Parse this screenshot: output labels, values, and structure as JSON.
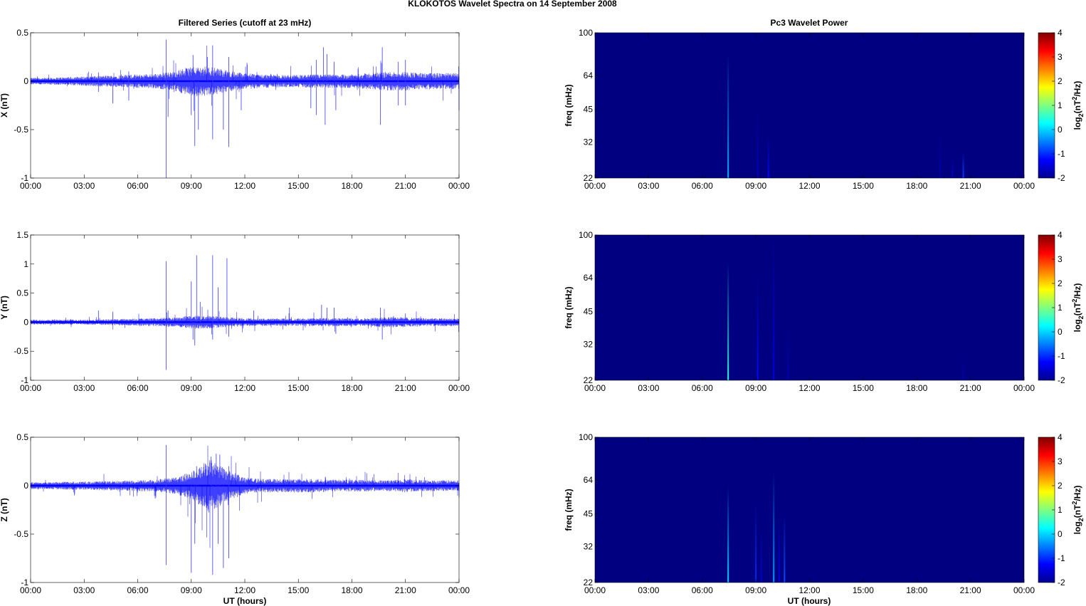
{
  "chart_data": {
    "title": "KLOKOTOS Wavelet Spectra on 14 September 2008",
    "left_title": "Filtered Series (cutoff at 23 mHz)",
    "right_title": "Pc3 Wavelet Power",
    "xlabel": "UT (hours)",
    "xticks": [
      "00:00",
      "03:00",
      "06:00",
      "09:00",
      "12:00",
      "15:00",
      "18:00",
      "21:00",
      "00:00"
    ],
    "xlim_hours": [
      0,
      24
    ],
    "series": [
      {
        "type": "line",
        "name": "X",
        "ylabel": "X (nT)",
        "ylim": [
          -1,
          0.5
        ],
        "yticks": [
          0.5,
          0,
          -0.5,
          -1
        ],
        "ytick_labels": [
          "0.5",
          "0",
          "-0.5",
          "-1"
        ],
        "noise_amp_hourly": [
          0.025,
          0.025,
          0.03,
          0.035,
          0.04,
          0.045,
          0.05,
          0.055,
          0.07,
          0.11,
          0.11,
          0.08,
          0.06,
          0.05,
          0.045,
          0.045,
          0.05,
          0.05,
          0.05,
          0.06,
          0.07,
          0.07,
          0.06,
          0.06,
          0.06
        ],
        "spikes": [
          [
            3.8,
            0.09
          ],
          [
            3.8,
            -0.11
          ],
          [
            4.6,
            -0.23
          ],
          [
            5.5,
            -0.2
          ],
          [
            5.5,
            0.1
          ],
          [
            7.6,
            0.43
          ],
          [
            7.6,
            -1.0
          ],
          [
            7.7,
            -0.37
          ],
          [
            9.0,
            -0.35
          ],
          [
            9.1,
            0.27
          ],
          [
            9.2,
            -0.67
          ],
          [
            9.4,
            -0.5
          ],
          [
            9.9,
            0.25
          ],
          [
            10.2,
            0.37
          ],
          [
            10.2,
            -0.6
          ],
          [
            10.8,
            -0.5
          ],
          [
            11.1,
            0.25
          ],
          [
            11.1,
            -0.68
          ],
          [
            11.8,
            -0.3
          ],
          [
            15.7,
            -0.28
          ],
          [
            16.0,
            0.22
          ],
          [
            16.0,
            -0.35
          ],
          [
            16.4,
            0.35
          ],
          [
            16.5,
            -0.45
          ],
          [
            16.6,
            0.28
          ],
          [
            17.0,
            0.2
          ],
          [
            17.1,
            -0.3
          ],
          [
            19.6,
            -0.45
          ],
          [
            19.7,
            0.35
          ],
          [
            20.6,
            0.2
          ],
          [
            20.6,
            -0.25
          ],
          [
            21.0,
            0.22
          ],
          [
            21.0,
            -0.25
          ],
          [
            24.0,
            -0.3
          ]
        ]
      },
      {
        "type": "line",
        "name": "Y",
        "ylabel": "Y (nT)",
        "ylim": [
          -1,
          1.5
        ],
        "yticks": [
          1.5,
          1,
          0.5,
          0,
          -0.5,
          -1
        ],
        "ytick_labels": [
          "1.5",
          "1",
          "0.5",
          "0",
          "-0.5",
          "-1"
        ],
        "noise_amp_hourly": [
          0.03,
          0.03,
          0.03,
          0.03,
          0.035,
          0.04,
          0.045,
          0.05,
          0.06,
          0.08,
          0.08,
          0.06,
          0.05,
          0.045,
          0.045,
          0.045,
          0.05,
          0.05,
          0.05,
          0.05,
          0.07,
          0.06,
          0.05,
          0.05,
          0.05
        ],
        "spikes": [
          [
            3.8,
            0.2
          ],
          [
            4.6,
            0.18
          ],
          [
            7.6,
            1.05
          ],
          [
            7.6,
            -0.82
          ],
          [
            7.7,
            0.2
          ],
          [
            9.0,
            0.7
          ],
          [
            9.1,
            -0.3
          ],
          [
            9.3,
            1.15
          ],
          [
            9.2,
            -0.4
          ],
          [
            9.5,
            0.35
          ],
          [
            10.2,
            1.15
          ],
          [
            10.2,
            -0.3
          ],
          [
            10.5,
            0.6
          ],
          [
            11.0,
            1.1
          ],
          [
            11.1,
            -0.25
          ],
          [
            12.5,
            0.2
          ],
          [
            14.5,
            0.25
          ],
          [
            16.3,
            0.3
          ],
          [
            16.6,
            0.25
          ],
          [
            17.0,
            0.25
          ],
          [
            17.1,
            -0.2
          ],
          [
            19.6,
            0.25
          ],
          [
            19.7,
            -0.3
          ],
          [
            21.0,
            0.15
          ]
        ]
      },
      {
        "type": "line",
        "name": "Z",
        "ylabel": "Z (nT)",
        "ylim": [
          -1,
          0.5
        ],
        "yticks": [
          0.5,
          0,
          -0.5,
          -1
        ],
        "ytick_labels": [
          "0.5",
          "0",
          "-0.5",
          "-1"
        ],
        "noise_amp_hourly": [
          0.025,
          0.025,
          0.03,
          0.03,
          0.035,
          0.035,
          0.04,
          0.045,
          0.06,
          0.1,
          0.2,
          0.12,
          0.06,
          0.05,
          0.05,
          0.05,
          0.05,
          0.045,
          0.045,
          0.04,
          0.04,
          0.05,
          0.04,
          0.04,
          0.04
        ],
        "spikes": [
          [
            7.6,
            0.42
          ],
          [
            7.6,
            -0.82
          ],
          [
            9.0,
            -0.9
          ],
          [
            9.2,
            -0.6
          ],
          [
            9.3,
            0.2
          ],
          [
            10.1,
            0.3
          ],
          [
            10.2,
            -0.92
          ],
          [
            10.4,
            0.33
          ],
          [
            10.5,
            -0.6
          ],
          [
            10.6,
            0.32
          ],
          [
            10.8,
            -0.85
          ],
          [
            11.1,
            -0.75
          ],
          [
            11.1,
            0.2
          ],
          [
            24.0,
            -0.12
          ]
        ]
      }
    ],
    "wavelets": [
      {
        "type": "heatmap",
        "name": "X",
        "ylabel": "freq (mHz)",
        "ylim_mhz": [
          22,
          100
        ],
        "yscale": "log",
        "yticks": [
          100,
          64,
          45,
          32,
          22
        ],
        "background_log2": -2,
        "streaks": [
          [
            7.45,
            -0.2,
            80
          ],
          [
            9.1,
            -1.6,
            45
          ],
          [
            9.7,
            -1.2,
            34
          ],
          [
            19.3,
            -1.7,
            35
          ],
          [
            20.0,
            -1.6,
            28
          ],
          [
            20.6,
            -0.9,
            29
          ]
        ]
      },
      {
        "type": "heatmap",
        "name": "Y",
        "ylabel": "freq (mHz)",
        "ylim_mhz": [
          22,
          100
        ],
        "yscale": "log",
        "yticks": [
          100,
          64,
          45,
          32,
          22
        ],
        "background_log2": -2,
        "streaks": [
          [
            7.45,
            0.5,
            75
          ],
          [
            9.1,
            -1.2,
            65
          ],
          [
            10.0,
            -1.4,
            100
          ],
          [
            10.8,
            -1.7,
            40
          ],
          [
            20.6,
            -1.7,
            28
          ]
        ]
      },
      {
        "type": "heatmap",
        "name": "Z",
        "ylabel": "freq (mHz)",
        "ylim_mhz": [
          22,
          100
        ],
        "yscale": "log",
        "yticks": [
          100,
          64,
          45,
          32,
          22
        ],
        "background_log2": -2,
        "streaks": [
          [
            7.45,
            0.0,
            60
          ],
          [
            9.0,
            -1.0,
            50
          ],
          [
            9.3,
            -1.5,
            40
          ],
          [
            10.0,
            -0.3,
            70
          ],
          [
            10.3,
            -1.4,
            45
          ],
          [
            10.6,
            -0.8,
            45
          ]
        ]
      }
    ],
    "colorbar": {
      "label": "log2(nT2/Hz)",
      "label_main": "log",
      "label_sub": "2",
      "label_rest": "(nT",
      "label_sup": "2",
      "label_end": "/Hz)",
      "range": [
        -2,
        4
      ],
      "ticks": [
        "4",
        "3",
        "2",
        "1",
        "0",
        "-1",
        "-2"
      ]
    }
  }
}
